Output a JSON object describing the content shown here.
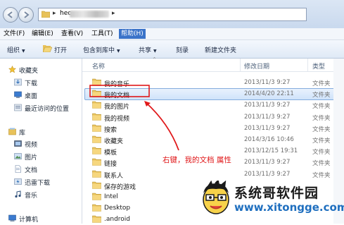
{
  "address": {
    "path_prefix": "hec",
    "separator": "▸"
  },
  "menu": [
    {
      "label": "文件(F)"
    },
    {
      "label": "编辑(E)"
    },
    {
      "label": "查看(V)"
    },
    {
      "label": "工具(T)"
    },
    {
      "label": "帮助(H)",
      "active": true
    }
  ],
  "toolbar": {
    "organize": "组织",
    "open": "打开",
    "include_in_library": "包含到库中",
    "share": "共享",
    "burn": "刻录",
    "new_folder": "新建文件夹"
  },
  "nav": {
    "favorites": "收藏夹",
    "downloads": "下载",
    "desktop": "桌面",
    "recent": "最近访问的位置",
    "libraries": "库",
    "videos": "视频",
    "pictures": "图片",
    "documents": "文档",
    "thunder": "迅雷下载",
    "music": "音乐",
    "computer": "计算机"
  },
  "columns": {
    "name": "名称",
    "modified": "修改日期",
    "type": "类型"
  },
  "files": [
    {
      "name": "我的音乐",
      "date": "2013/11/3 9:27",
      "type": "文件夹"
    },
    {
      "name": "我的文档",
      "date": "2014/4/20 22:11",
      "type": "文件夹",
      "selected": true
    },
    {
      "name": "我的图片",
      "date": "2013/11/3 9:27",
      "type": "文件夹"
    },
    {
      "name": "我的视频",
      "date": "2013/11/3 9:27",
      "type": "文件夹"
    },
    {
      "name": "搜索",
      "date": "2013/11/3 9:27",
      "type": "文件夹"
    },
    {
      "name": "收藏夹",
      "date": "2014/3/16 10:46",
      "type": "文件夹"
    },
    {
      "name": "模板",
      "date": "2013/12/15 19:31",
      "type": "文件夹"
    },
    {
      "name": "链接",
      "date": "2013/11/3 9:27",
      "type": "文件夹"
    },
    {
      "name": "联系人",
      "date": "2013/11/3 9:27",
      "type": "文件夹"
    },
    {
      "name": "保存的游戏",
      "date": "",
      "type": ""
    },
    {
      "name": "Intel",
      "date": "",
      "type": ""
    },
    {
      "name": "Desktop",
      "date": "",
      "type": ""
    },
    {
      "name": ".android",
      "date": "",
      "type": ""
    }
  ],
  "annotation": {
    "text": "右键，我的文档 属性",
    "color": "#e0181a"
  },
  "watermark": {
    "title": "系统哥软件园",
    "url": "www.xitongge.com"
  }
}
